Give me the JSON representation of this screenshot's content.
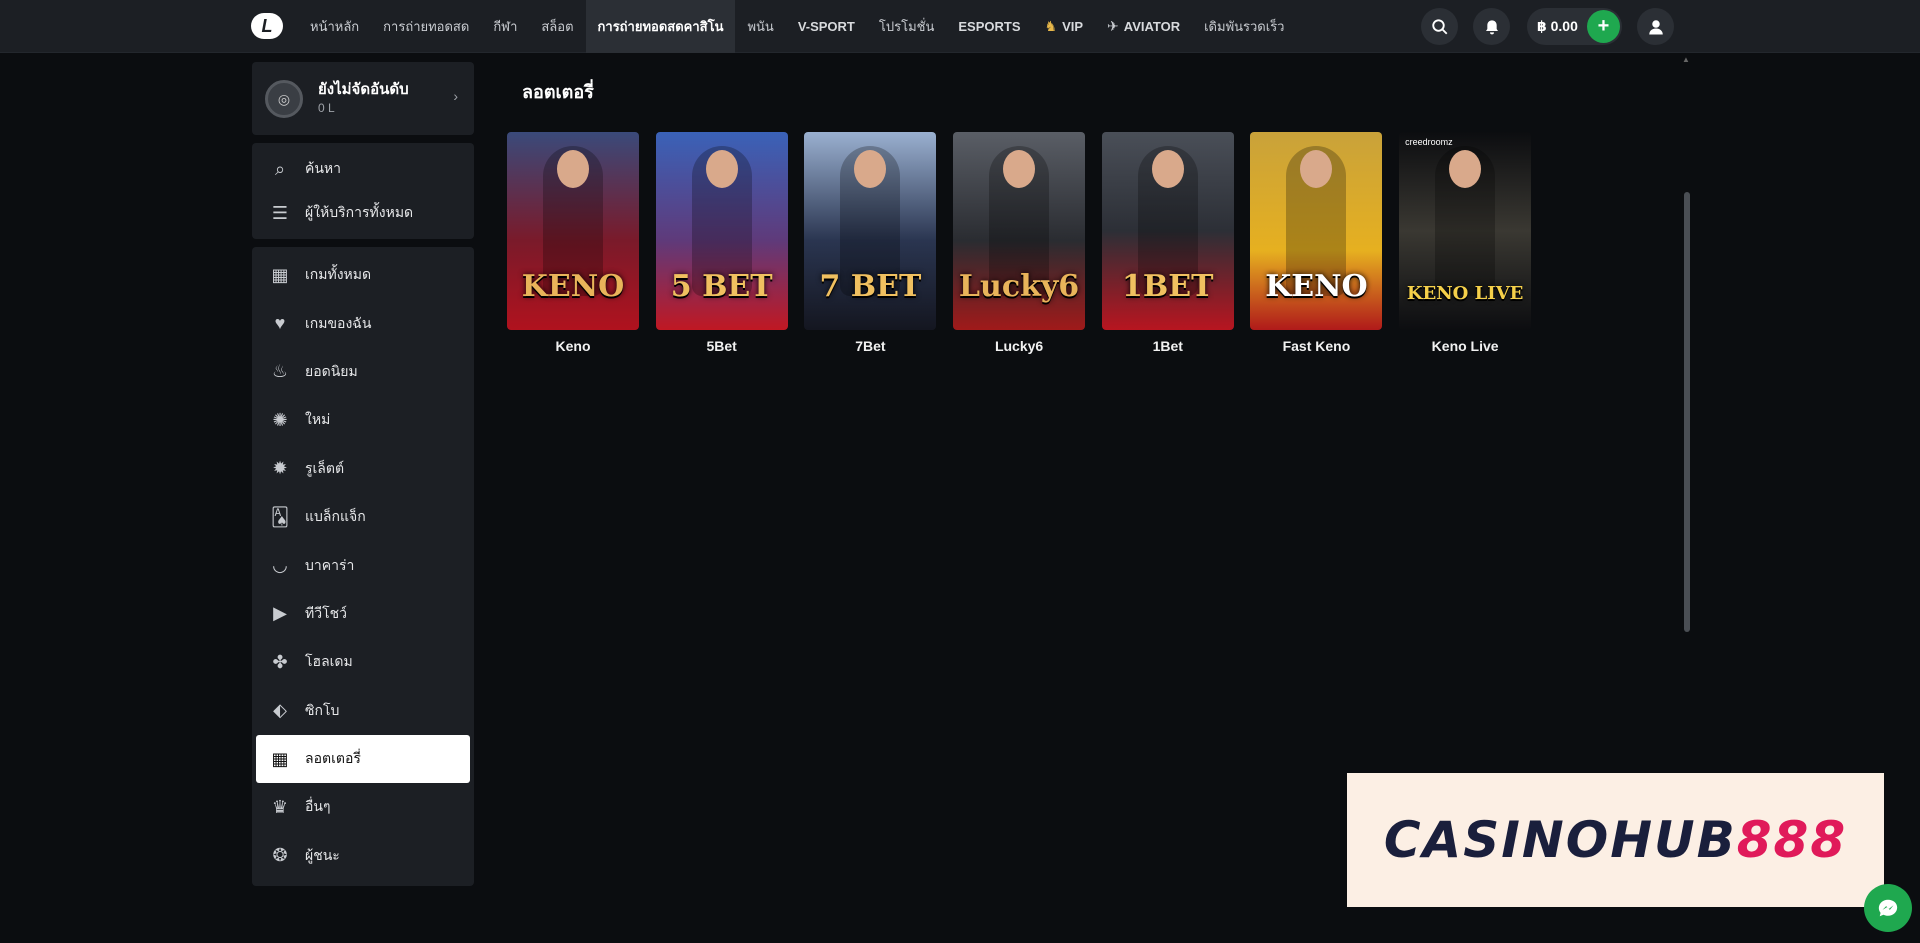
{
  "header": {
    "logo_text": "L",
    "nav": [
      {
        "label": "หน้าหลัก",
        "icon": ""
      },
      {
        "label": "การถ่ายทอดสด",
        "icon": ""
      },
      {
        "label": "กีฬา",
        "icon": ""
      },
      {
        "label": "สล็อต",
        "icon": ""
      },
      {
        "label": "การถ่ายทอดสดคาสิโน",
        "icon": "",
        "active": true
      },
      {
        "label": "พนัน",
        "icon": ""
      },
      {
        "label": "V-SPORT",
        "icon": ""
      },
      {
        "label": "โปรโมชั่น",
        "icon": ""
      },
      {
        "label": "ESPORTS",
        "icon": ""
      },
      {
        "label": "VIP",
        "icon": "vip-shield-icon"
      },
      {
        "label": "AVIATOR",
        "icon": "aviator-icon"
      },
      {
        "label": "เดิมพันรวดเร็ว",
        "icon": ""
      }
    ],
    "balance": "฿ 0.00",
    "add_icon": "+"
  },
  "sidebar": {
    "rank_title": "ยังไม่จัดอันดับ",
    "rank_sub": "0 L",
    "tools": [
      {
        "label": "ค้นหา",
        "icon": "search-icon"
      },
      {
        "label": "ผู้ให้บริการทั้งหมด",
        "icon": "filter-icon"
      }
    ],
    "categories": [
      {
        "label": "เกมทั้งหมด",
        "icon": "grid-icon"
      },
      {
        "label": "เกมของฉัน",
        "icon": "heart-icon"
      },
      {
        "label": "ยอดนิยม",
        "icon": "flame-icon"
      },
      {
        "label": "ใหม่",
        "icon": "new-chip-icon"
      },
      {
        "label": "รูเล็ตต์",
        "icon": "roulette-icon"
      },
      {
        "label": "แบล็กแจ็ก",
        "icon": "cards-icon"
      },
      {
        "label": "บาคาร่า",
        "icon": "baccarat-icon"
      },
      {
        "label": "ทีวีโชว์",
        "icon": "play-icon"
      },
      {
        "label": "โฮลเดม",
        "icon": "holdem-icon"
      },
      {
        "label": "ซิกโบ",
        "icon": "dice-icon"
      },
      {
        "label": "ลอตเตอรี่",
        "icon": "lottery-icon",
        "active": true
      },
      {
        "label": "อื่นๆ",
        "icon": "crown-icon"
      },
      {
        "label": "ผู้ชนะ",
        "icon": "winners-icon"
      }
    ]
  },
  "main": {
    "title": "ลอตเตอรี่",
    "games": [
      {
        "name": "Keno",
        "art": "KENO",
        "bg": "linear-gradient(180deg,#3a4a7a 0%,#7a1a2a 55%,#b0121e 100%)",
        "color": "#e9b45a"
      },
      {
        "name": "5Bet",
        "art": "5 BET",
        "bg": "linear-gradient(180deg,#3a62b8 0%,#5f3a7a 55%,#c01823 100%)",
        "color": "#f0c060"
      },
      {
        "name": "7Bet",
        "art": "7 BET",
        "bg": "linear-gradient(180deg,#9ab0d0 0%,#2a3550 55%,#141620 100%)",
        "color": "#f0c060"
      },
      {
        "name": "Lucky6",
        "art": "Lucky6",
        "bg": "linear-gradient(180deg,#5a5e66 0%,#2a2c31 55%,#a01a1a 100%)",
        "color": "#e9b45a"
      },
      {
        "name": "1Bet",
        "art": "1BET",
        "bg": "linear-gradient(180deg,#4a4f58 0%,#2c2f36 50%,#b81520 100%)",
        "color": "#f0c060"
      },
      {
        "name": "Fast Keno",
        "art": "KENO",
        "bg": "linear-gradient(180deg,#c9a23a 0%,#e6b020 60%,#b01a1a 100%)",
        "color": "#ffffff"
      },
      {
        "name": "Keno Live",
        "art": "KENO LIVE",
        "bg": "linear-gradient(180deg,#0c0d10 0%,#3a3832 50%,#0c0d10 100%)",
        "color": "#f5d04a",
        "tag": "creedroomz"
      }
    ]
  },
  "banner": {
    "part1": "CASINOHUB",
    "part2": "888"
  }
}
